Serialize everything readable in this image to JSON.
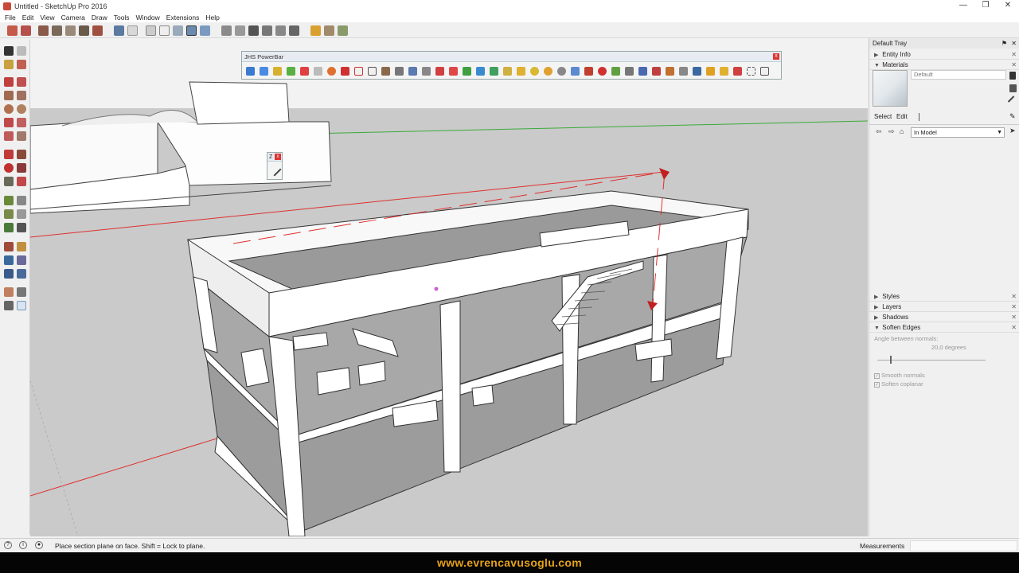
{
  "window": {
    "title": "Untitled - SketchUp Pro 2016",
    "minimize": "—",
    "restore": "❐",
    "close": "✕"
  },
  "menu": [
    "File",
    "Edit",
    "View",
    "Camera",
    "Draw",
    "Tools",
    "Window",
    "Extensions",
    "Help"
  ],
  "powerbar": {
    "title": "JHS PowerBar",
    "close": "x"
  },
  "mini_toolbar": {
    "label": "Z",
    "close": "x"
  },
  "tray": {
    "title": "Default Tray",
    "sections_top": [
      {
        "label": "Entity Info",
        "expanded": false
      },
      {
        "label": "Materials",
        "expanded": true
      }
    ],
    "material_name": "Default",
    "tabs": [
      "Select",
      "Edit"
    ],
    "library": "In Model",
    "sections_bottom": [
      {
        "label": "Styles",
        "expanded": false
      },
      {
        "label": "Layers",
        "expanded": false
      },
      {
        "label": "Shadows",
        "expanded": false
      },
      {
        "label": "Soften Edges",
        "expanded": true
      }
    ],
    "soften": {
      "angle_label": "Angle between normals:",
      "angle_value": "20,0  degrees",
      "smooth_normals": "Smooth normals",
      "soften_coplanar": "Soften coplanar"
    }
  },
  "status": {
    "text": "Place section plane on face.  Shift = Lock to plane.",
    "measurements_label": "Measurements"
  },
  "footer": {
    "url": "www.evrencavusoglu.com"
  }
}
